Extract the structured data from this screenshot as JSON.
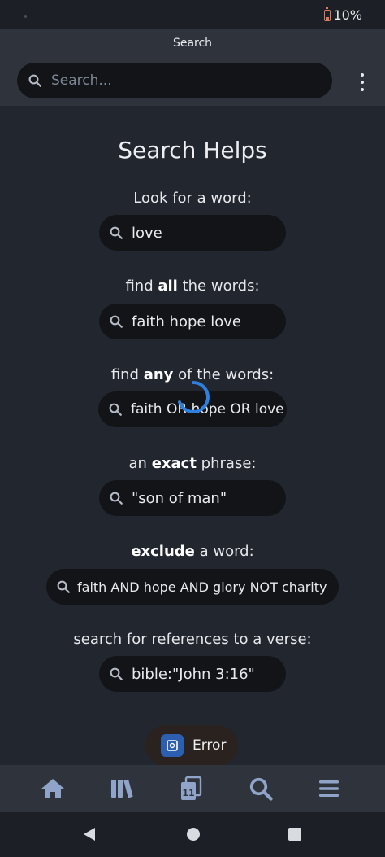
{
  "status_bar": {
    "battery": "10%"
  },
  "app_bar": {
    "title": "Search",
    "search_placeholder": "Search..."
  },
  "helps": {
    "title": "Search Helps",
    "sections": [
      {
        "pre": "Look for a word:",
        "bold": "",
        "post": "",
        "example": "love"
      },
      {
        "pre": "find ",
        "bold": "all",
        "post": " the words:",
        "example": "faith hope love"
      },
      {
        "pre": "find ",
        "bold": "any",
        "post": " of the words:",
        "example": "faith OR hope OR love"
      },
      {
        "pre": "an ",
        "bold": "exact",
        "post": " phrase:",
        "example": "\"son of man\""
      },
      {
        "pre": "",
        "bold": "exclude",
        "post": " a word:",
        "example": "faith AND hope AND glory NOT charity"
      },
      {
        "pre": "search for references to a verse:",
        "bold": "",
        "post": "",
        "example": "bible:\"John 3:16\""
      }
    ]
  },
  "toast": {
    "text": "Error"
  },
  "bottom_nav": {
    "items": [
      {
        "icon": "home-icon"
      },
      {
        "icon": "library-icon"
      },
      {
        "icon": "calendar-icon",
        "badge": "11"
      },
      {
        "icon": "search-icon"
      },
      {
        "icon": "menu-icon"
      }
    ]
  },
  "colors": {
    "background": "#22262e",
    "app_bar": "#2f343c",
    "pill": "#121418",
    "accent": "#2f7fdf"
  }
}
